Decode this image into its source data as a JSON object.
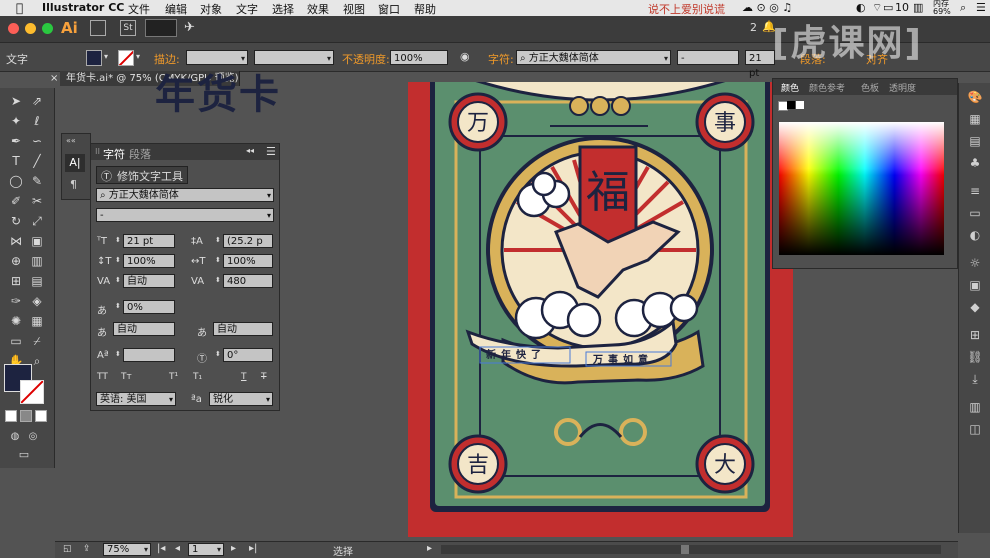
{
  "menubar": {
    "app_name": "Illustrator CC",
    "items": [
      "文件",
      "编辑",
      "对象",
      "文字",
      "选择",
      "效果",
      "视图",
      "窗口",
      "帮助"
    ],
    "notice": "说不上爱别说谎",
    "num_2": "2",
    "num_10": "10",
    "mem": "内存",
    "mem_pct": "69%"
  },
  "titlestrip": {
    "ai_badge": "Ai"
  },
  "controlbar": {
    "type_label": "文字",
    "stroke_label": "描边:",
    "opacity_label": "不透明度:",
    "opacity_value": "100%",
    "char_label": "字符:",
    "font_value": "方正大魏体简体",
    "style_value": "-",
    "size_value": "21 pt",
    "para_label": "段落:",
    "align_label": "对齐"
  },
  "doctab": {
    "title": "年货卡.ai* @ 75% (CMYK/GPU 预览)"
  },
  "canvas": {
    "heading_partial": "年货卡"
  },
  "char_panel": {
    "tab_char": "字符",
    "tab_para": "段落",
    "touch_tool": "修饰文字工具",
    "font_family": "方正大魏体简体",
    "font_style": "-",
    "size": "21 pt",
    "leading": "(25.2 p",
    "vscale": "100%",
    "hscale": "100%",
    "kerning": "自动",
    "tracking": "480",
    "tsume": "0%",
    "aki_left": "自动",
    "aki_right": "自动",
    "baseline": "",
    "rotation": "0°",
    "language": "英语: 美国",
    "antialias": "锐化",
    "tt_labels": [
      "TT",
      "Tт",
      "T¹",
      "T₁",
      "T",
      "T"
    ]
  },
  "color_panel": {
    "tabs": [
      "颜色",
      "颜色参考",
      "色板",
      "透明度"
    ]
  },
  "artwork": {
    "corner_tl": "万",
    "corner_tr": "事",
    "corner_bl": "吉",
    "corner_br": "大",
    "center_char": "福",
    "ribbon_left": "新年快了",
    "ribbon_right": "万事如意"
  },
  "statusbar": {
    "zoom": "75%",
    "page": "1",
    "tool": "选择"
  },
  "watermark": {
    "text": "[虎课网]"
  },
  "colors": {
    "artboard_red": "#c22e2e",
    "card_green": "#5b8f6e",
    "gold": "#d9b25a",
    "navy": "#1d2340",
    "cream": "#f3e6c8",
    "accent_orange": "#f09a2a"
  }
}
